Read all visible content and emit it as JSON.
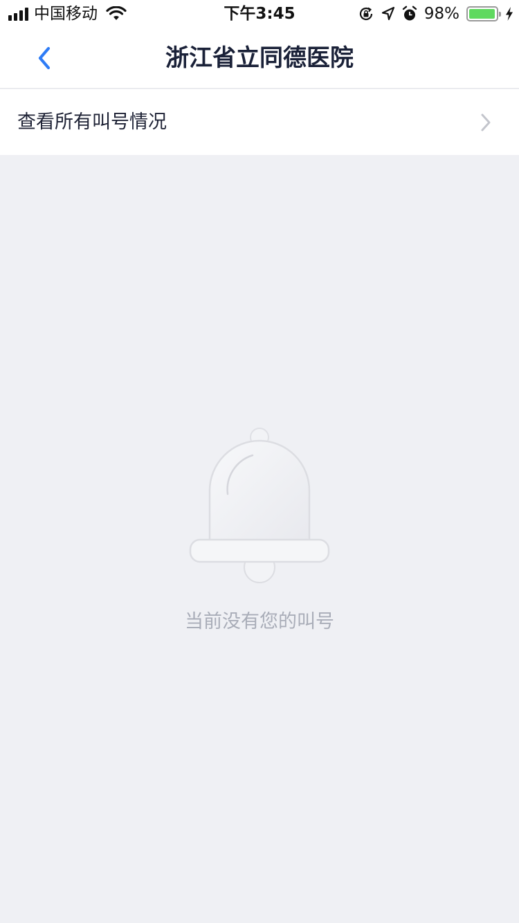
{
  "status_bar": {
    "carrier": "中国移动",
    "time": "下午3:45",
    "battery_percent": "98%",
    "battery_level": 0.98,
    "icons": [
      "signal-icon",
      "wifi-icon",
      "orientation-lock-icon",
      "location-icon",
      "alarm-icon",
      "battery-icon",
      "charging-icon"
    ]
  },
  "nav": {
    "title": "浙江省立同德医院",
    "back_icon": "chevron-left-icon"
  },
  "row": {
    "label": "查看所有叫号情况",
    "icon": "chevron-right-icon"
  },
  "empty_state": {
    "icon": "bell-icon",
    "message": "当前没有您的叫号"
  },
  "colors": {
    "accent": "#2e7cf6",
    "background": "#eff0f4",
    "title": "#1a2138",
    "muted": "#a9adb8",
    "battery": "#5fd95f"
  }
}
